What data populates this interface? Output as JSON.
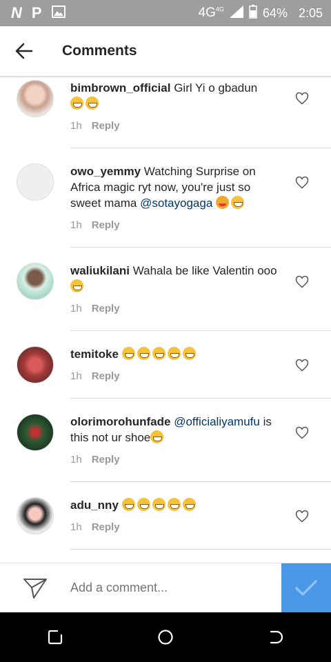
{
  "status_bar": {
    "icons": [
      "n-icon",
      "p-icon",
      "image-icon"
    ],
    "network": "4G",
    "network_sup": "4G",
    "battery": "64%",
    "time": "2:05"
  },
  "header": {
    "title": "Comments"
  },
  "comments": [
    {
      "username": "bimbrown_official",
      "text": "Girl Yi o gbadun",
      "emojis": 2,
      "time": "1h",
      "reply": "Reply"
    },
    {
      "username": "owo_yemmy",
      "text": "Watching Surprise on Africa magic ryt now, you're just so sweet mama",
      "mention": "@sotayogaga",
      "time": "1h",
      "reply": "Reply"
    },
    {
      "username": "waliukilani",
      "text": "Wahala be like Valentin ooo",
      "emojis": 1,
      "time": "1h",
      "reply": "Reply"
    },
    {
      "username": "temitoke",
      "text": "",
      "emojis": 5,
      "time": "1h",
      "reply": "Reply"
    },
    {
      "username": "olorimorohunfade",
      "mention": "@officialiyamufu",
      "text": "is this not ur shoe",
      "emojis": 1,
      "time": "1h",
      "reply": "Reply"
    },
    {
      "username": "adu_nny",
      "text": "",
      "emojis": 5,
      "time": "1h",
      "reply": "Reply"
    }
  ],
  "composer": {
    "placeholder": "Add a comment..."
  },
  "colors": {
    "accent": "#4a97e8",
    "mention": "#003569",
    "status_bar": "#9e9e9e"
  }
}
